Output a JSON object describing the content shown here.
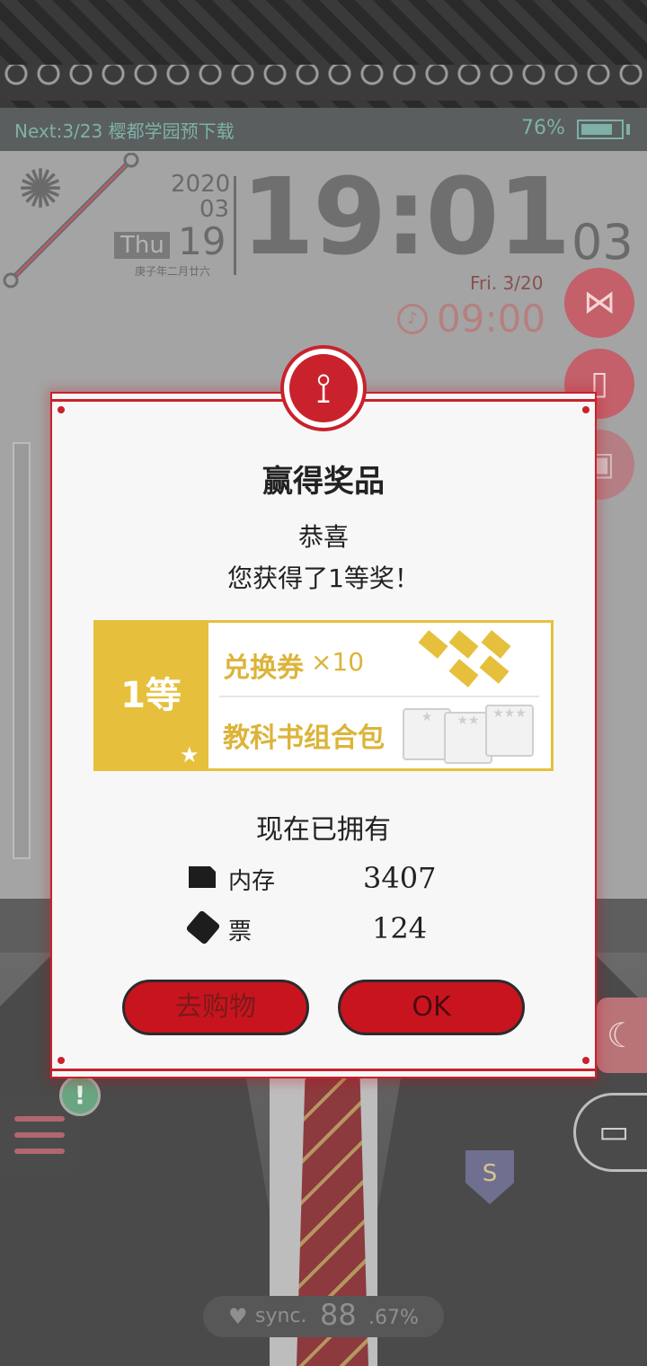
{
  "status": {
    "next_info": "Next:3/23 樱都学园预下载",
    "battery": "76%"
  },
  "clock": {
    "year": "2020",
    "month": "03",
    "weekday": "Thu",
    "day": "19",
    "lunar": "庚子年二月廿六",
    "time": "19:01",
    "seconds": "03",
    "date_en": "Fri.  3/20",
    "alarm": "09:00"
  },
  "dialog": {
    "title": "赢得奖品",
    "congrats": "恭喜",
    "message": "您获得了1等奖！",
    "prize_tier": "1等",
    "prizes": [
      {
        "name": "兑换券",
        "qty": "×10"
      },
      {
        "name": "教科书组合包"
      }
    ],
    "owned_title": "现在已拥有",
    "owned": [
      {
        "label": "内存",
        "value": "3407"
      },
      {
        "label": "票",
        "value": "124"
      }
    ],
    "shop_label": "去购物",
    "ok_label": "OK"
  },
  "sync": {
    "label": "sync.",
    "value": "88",
    "decimal": ".67%"
  },
  "colors": {
    "accent_red": "#c9222c",
    "gold": "#e6c03d",
    "teal": "#7fb0a8"
  },
  "icons": [
    "share-icon",
    "book-icon",
    "gift-icon",
    "moon-icon",
    "open-book-icon",
    "menu-icon",
    "alert-icon",
    "heart-icon",
    "syringe-icon",
    "alarm-icon",
    "star-icon"
  ]
}
